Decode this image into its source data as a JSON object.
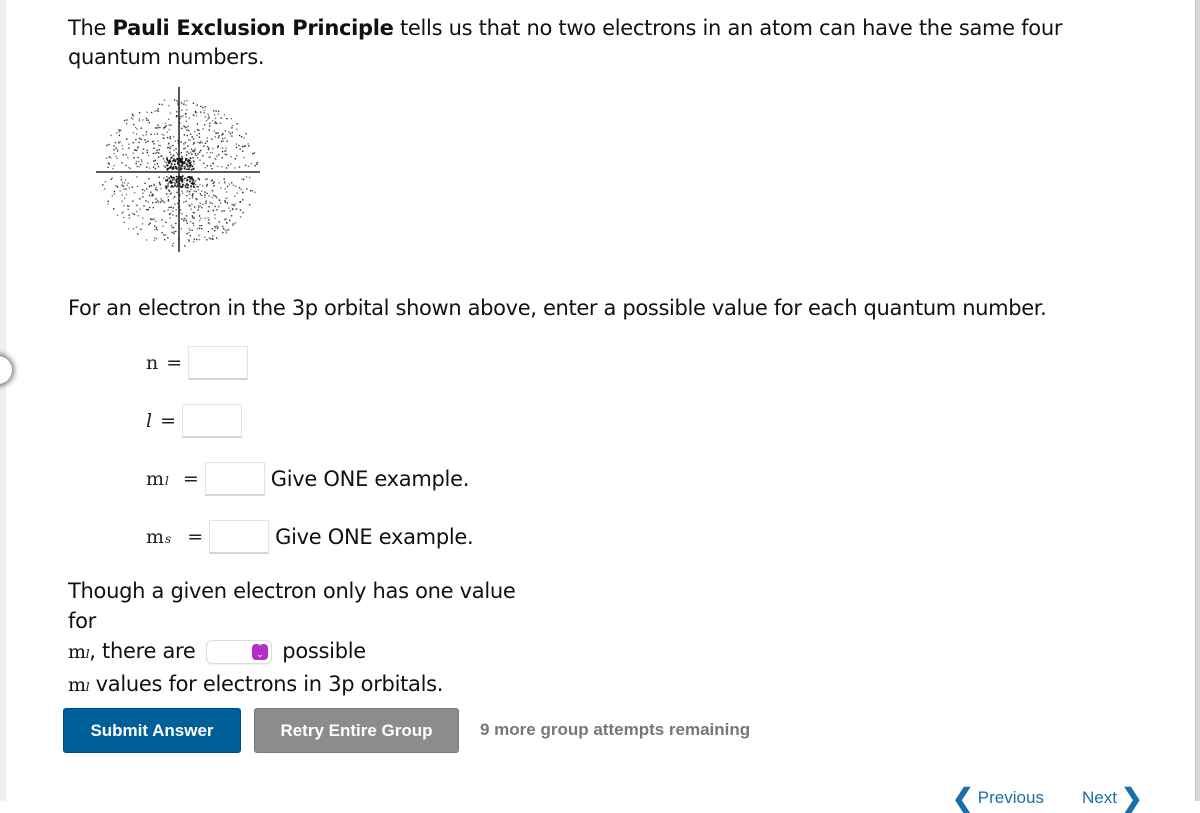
{
  "intro": {
    "prefix": "The ",
    "bold": "Pauli Exclusion Principle",
    "suffix": " tells us that no two electrons in an atom can have the same four quantum numbers."
  },
  "orbital_image": {
    "description": "3p orbital electron density dot plot with x and y axes"
  },
  "prompt": "For an electron in the 3p orbital shown above, enter a possible value for each quantum number.",
  "quantum_numbers": [
    {
      "symbol": "n",
      "subscript": "",
      "equals": "=",
      "value": "",
      "hint": ""
    },
    {
      "symbol": "l",
      "subscript": "",
      "equals": "=",
      "value": "",
      "hint": ""
    },
    {
      "symbol": "m",
      "subscript": "l",
      "equals": "=",
      "value": "",
      "hint": "Give ONE example."
    },
    {
      "symbol": "m",
      "subscript": "s",
      "equals": "=",
      "value": "",
      "hint": "Give ONE example."
    }
  ],
  "paragraph": {
    "line1": "Though a given electron only has one value for",
    "ml_symbol": "m",
    "ml_subscript": "l",
    "line2_mid": ", there are",
    "select_value": "",
    "line2_end": "possible",
    "line3_end": " values for electrons in 3p orbitals."
  },
  "buttons": {
    "submit": "Submit Answer",
    "retry": "Retry Entire Group"
  },
  "attempts_text": "9 more group attempts remaining",
  "navigation": {
    "previous": "Previous",
    "next": "Next"
  },
  "colors": {
    "submit": "#005e99",
    "retry": "#8c8c8c",
    "select_accent": "#b12fc4",
    "nav_link": "#1a6fa8"
  }
}
